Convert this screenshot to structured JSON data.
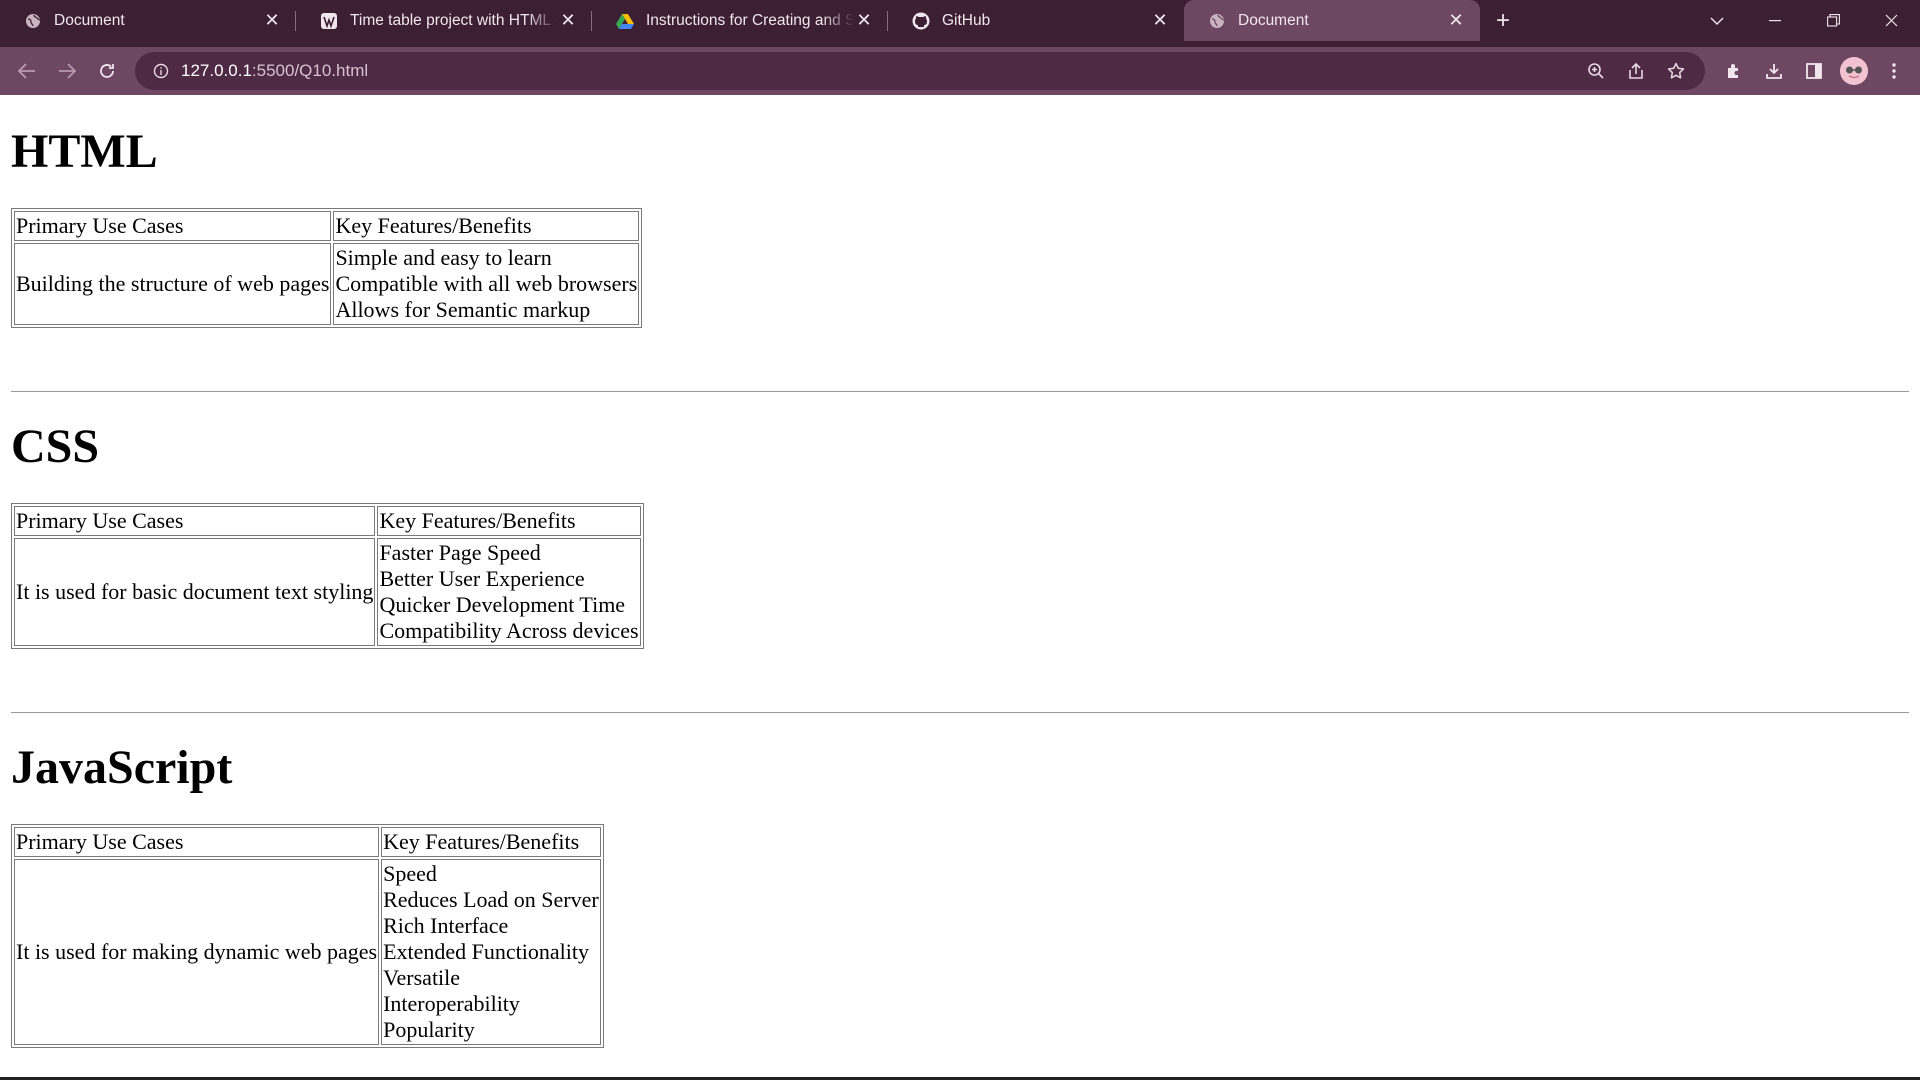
{
  "browser": {
    "tabs": [
      {
        "label": "Document",
        "favicon": "globe-icon",
        "active": false
      },
      {
        "label": "Time table project with HTML - I",
        "favicon": "wordpress-icon",
        "active": false
      },
      {
        "label": "Instructions for Creating and Sul",
        "favicon": "google-drive-icon",
        "active": false
      },
      {
        "label": "GitHub",
        "favicon": "github-icon",
        "active": false
      },
      {
        "label": "Document",
        "favicon": "globe-icon",
        "active": true
      }
    ],
    "url_host": "127.0.0.1",
    "url_path": ":5500/Q10.html",
    "colors": {
      "tabbar": "#3c1f33",
      "toolbar": "#6e4862",
      "omnibox": "#4f2a44"
    }
  },
  "sections": [
    {
      "heading": "HTML",
      "col1_header": "Primary Use Cases",
      "col2_header": "Key Features/Benefits",
      "use_case": "Building the structure of web pages",
      "features": [
        "Simple and easy to learn",
        "Compatible with all web browsers",
        "Allows for Semantic markup"
      ]
    },
    {
      "heading": "CSS",
      "col1_header": "Primary Use Cases",
      "col2_header": "Key Features/Benefits",
      "use_case": "It is used for basic document text styling",
      "features": [
        "Faster Page Speed",
        "Better User Experience",
        "Quicker Development Time",
        "Compatibility Across devices"
      ]
    },
    {
      "heading": "JavaScript",
      "col1_header": "Primary Use Cases",
      "col2_header": "Key Features/Benefits",
      "use_case": "It is used for making dynamic web pages",
      "features": [
        "Speed",
        "Reduces Load on Server",
        "Rich Interface",
        "Extended Functionality",
        "Versatile",
        "Interoperability",
        "Popularity"
      ]
    }
  ]
}
